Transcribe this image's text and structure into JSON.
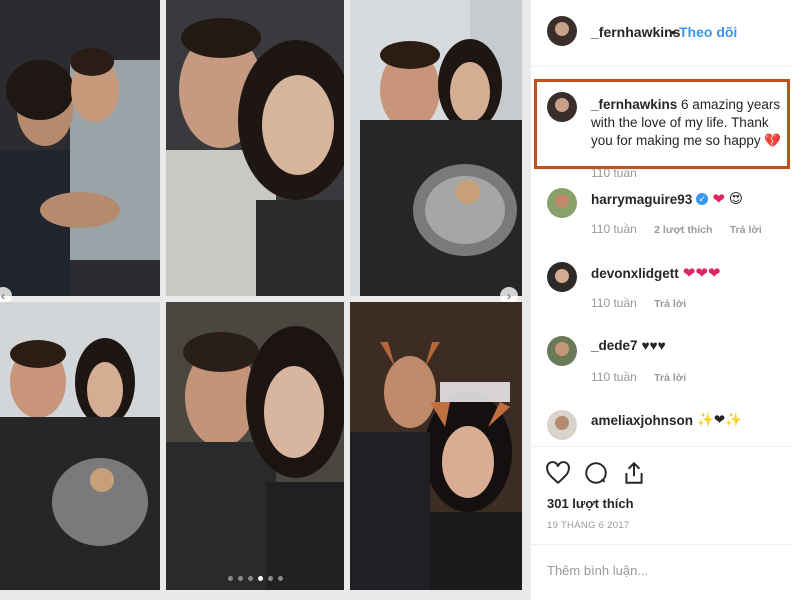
{
  "post": {
    "username": "_fernhawkins",
    "bullet": "•",
    "follow_label": "Theo dõi",
    "caption_user": "_fernhawkins",
    "caption_text": "6 amazing years with the love of my life. Thank you for making me so happy",
    "caption_emoji": "💔",
    "caption_age": "110 tuần",
    "likes": "301 lượt thích",
    "date": "19 THÁNG 6 2017",
    "add_comment_placeholder": "Thêm bình luận..."
  },
  "comments": [
    {
      "user": "harrymaguire93",
      "text": "✔ ❤ 😍",
      "age": "110 tuần",
      "likes_label": "2 lượt thích",
      "reply_label": "Trả lời"
    },
    {
      "user": "devonxlidgett",
      "text": "❤❤❤",
      "age": "110 tuần",
      "reply_label": "Trả lời"
    },
    {
      "user": "_dede7",
      "text": "♥♥♥",
      "age": "110 tuần",
      "reply_label": "Trả lời"
    },
    {
      "user": "ameliaxjohnson",
      "text": "✨❤✨"
    }
  ],
  "icons": {
    "like": "heart-outline-icon",
    "comment": "comment-bubble-icon",
    "share": "share-icon"
  },
  "colors": {
    "accent": "#3897f0",
    "highlight_border": "#c0501c",
    "text": "#262626",
    "muted": "#999999"
  }
}
